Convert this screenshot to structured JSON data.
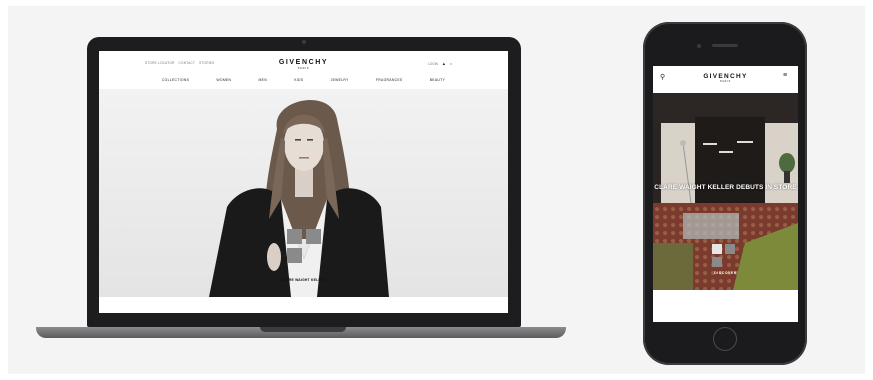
{
  "desktop": {
    "utility_links": [
      "Store Locator",
      "Contact",
      "Stories"
    ],
    "logo": "GIVENCHY",
    "logo_sub": "PARIS",
    "right_label": "Login",
    "nav_items": [
      "Collections",
      "Women",
      "Men",
      "Kids",
      "Jewelry",
      "Fragrances",
      "Beauty"
    ],
    "hero_caption": "CLARE WAIGHT KELLER"
  },
  "mobile": {
    "logo": "GIVENCHY",
    "logo_sub": "PARIS",
    "headline": "CLARE WAIGHT KELLER DEBUTS IN STORE",
    "cta": "DISCOVER"
  },
  "icons": {
    "desktop_search": "search-icon",
    "desktop_account": "user-icon",
    "desktop_bag": "bag-icon",
    "mobile_search": "search-icon",
    "mobile_menu": "menu-icon",
    "hero_logo_mark": "givenchy-4g-logo-mark"
  },
  "colors": {
    "device_dark": "#1d1d1f",
    "backdrop": "#f4f4f4",
    "text_primary": "#111111"
  }
}
